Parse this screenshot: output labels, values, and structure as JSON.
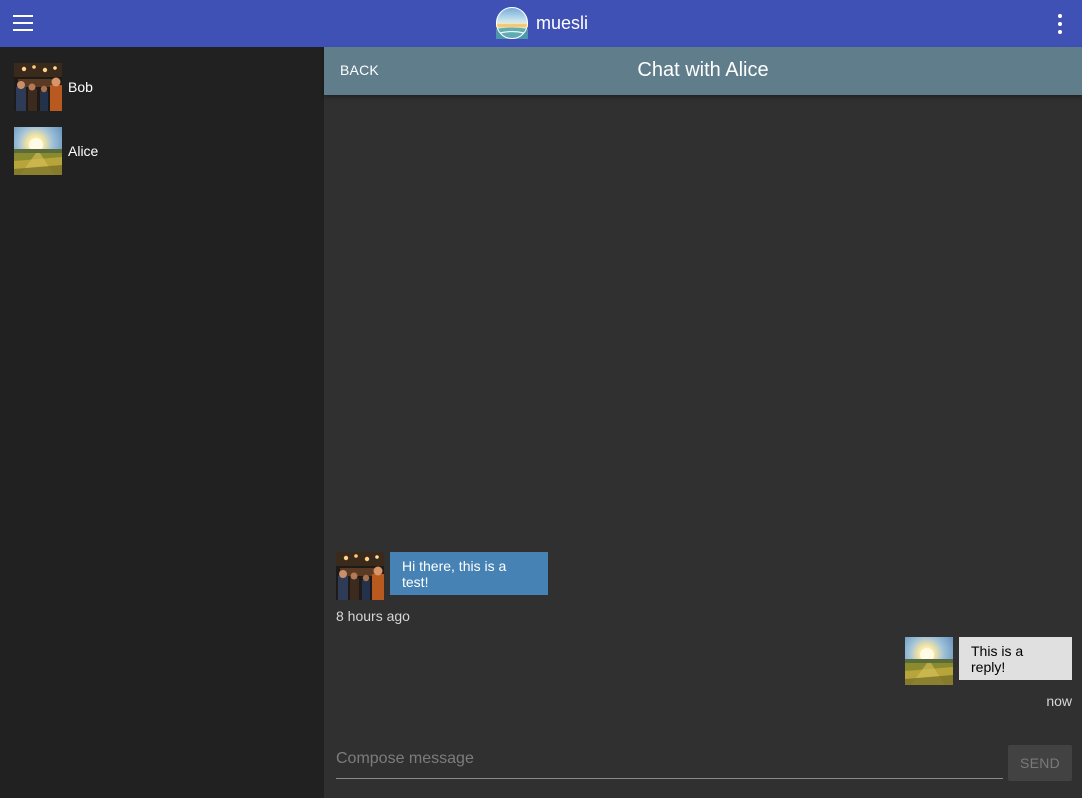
{
  "app": {
    "name": "muesli",
    "menu_icon": "hamburger-menu-icon",
    "more_icon": "more-vertical-icon",
    "logo": "muesli-logo"
  },
  "colors": {
    "app_bar": "#3f51b5",
    "chat_header": "#607d8b",
    "sidebar_bg": "#212121",
    "chat_bg": "#303030",
    "incoming_bubble": "#4682b4",
    "outgoing_bubble": "#e0e0e0",
    "send_button_disabled": "#424242"
  },
  "sidebar": {
    "contacts": [
      {
        "name": "Bob",
        "avatar": "bob-avatar"
      },
      {
        "name": "Alice",
        "avatar": "alice-avatar"
      }
    ]
  },
  "chat": {
    "back_label": "BACK",
    "title": "Chat with Alice",
    "messages": [
      {
        "direction": "incoming",
        "avatar": "bob-avatar",
        "text": "Hi there, this is a test!",
        "time": "8 hours ago"
      },
      {
        "direction": "outgoing",
        "avatar": "alice-avatar",
        "text": "This is a reply!",
        "time": "now"
      }
    ]
  },
  "compose": {
    "placeholder": "Compose message",
    "value": "",
    "send_label": "SEND",
    "send_enabled": false
  }
}
